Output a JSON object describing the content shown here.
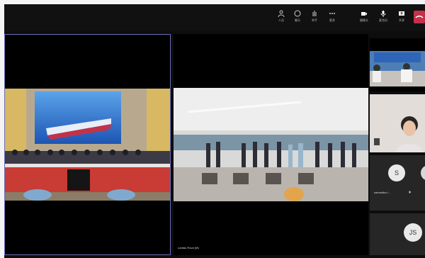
{
  "toolbar": {
    "buttons": [
      {
        "id": "people",
        "label": "人员",
        "icon": "people-icon"
      },
      {
        "id": "chat",
        "label": "聊天",
        "icon": "chat-icon"
      },
      {
        "id": "react",
        "label": "举手",
        "icon": "raise-hand-icon"
      },
      {
        "id": "more",
        "label": "更多",
        "icon": "more-icon"
      },
      {
        "id": "camera",
        "label": "摄像头",
        "icon": "camera-icon"
      },
      {
        "id": "mic",
        "label": "麦克风",
        "icon": "mic-icon"
      },
      {
        "id": "share",
        "label": "共享",
        "icon": "share-icon"
      }
    ],
    "leave_icon": "leave-phone-icon"
  },
  "main_video_label": "Lantau Rova (M)",
  "side_participants": [
    {
      "initial": "S",
      "name": "samantha l..."
    },
    {
      "initial": "JS",
      "name": ""
    }
  ],
  "colors": {
    "accent": "#6b6db7",
    "leave": "#c4314b",
    "screen_blue": "#2a6fcf"
  }
}
